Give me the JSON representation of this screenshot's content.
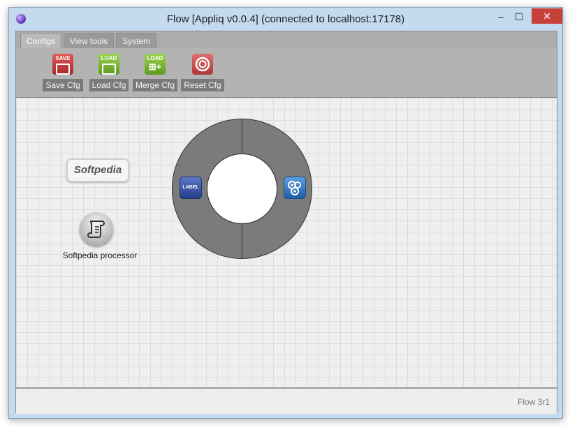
{
  "window": {
    "title": "Flow [Appliq v0.0.4] (connected to localhost:17178)",
    "controls": {
      "minimize": "–",
      "maximize": "☐",
      "close": "✕"
    }
  },
  "tabs": [
    {
      "label": "Configs",
      "active": true
    },
    {
      "label": "View tools",
      "active": false
    },
    {
      "label": "System",
      "active": false
    }
  ],
  "tools": {
    "save": {
      "label": "Save Cfg",
      "icon_text": "SAVE",
      "color": "#c83a3a"
    },
    "load": {
      "label": "Load Cfg",
      "icon_text": "LOAD",
      "color": "#7fb833"
    },
    "merge": {
      "label": "Merge Cfg",
      "icon_text": "LOAD",
      "color": "#7fb833"
    },
    "reset": {
      "label": "Reset Cfg",
      "icon_text": "",
      "color": "#c94a4a"
    }
  },
  "canvas": {
    "label_node": {
      "text": "Softpedia"
    },
    "processor_node": {
      "name": "Softpedia processor",
      "icon": "scroll-icon"
    },
    "ring_menu": {
      "left_icon": {
        "name": "label-icon",
        "text": "LABEL"
      },
      "right_icon": {
        "name": "gears-icon"
      }
    }
  },
  "status": {
    "version": "Flow 3r1"
  }
}
